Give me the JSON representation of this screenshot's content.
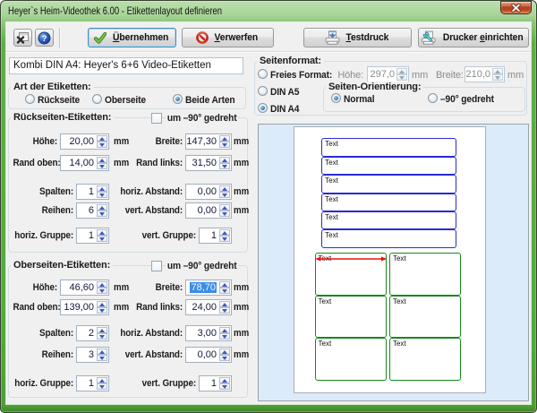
{
  "window": {
    "title": "Heyer`s Heim-Videothek 6.00 - Etikettenlayout definieren"
  },
  "toolbar": {
    "window_button_icon": "window-close-icon",
    "help_button_icon": "help-icon",
    "apply": {
      "label_prefix": "Ü",
      "label_rest": "bernehmen",
      "icon": "check-icon"
    },
    "discard": {
      "label_prefix": "V",
      "label_rest": "erwerfen",
      "icon": "no-entry-icon"
    },
    "test_print": {
      "label_prefix": "T",
      "label_rest": "estdruck",
      "icon": "printer-icon"
    },
    "printer_setup": {
      "label_pre": "Drucker ",
      "label_accel": "e",
      "label_rest": "inrichten",
      "icon": "printer-wrench-icon"
    }
  },
  "left_panel": {
    "layout_name_value": "Kombi DIN A4: Heyer's 6+6 Video-Etiketten",
    "label_type_group": {
      "legend": "Art der Etiketten:",
      "options": [
        {
          "label": "Rückseite",
          "selected": false
        },
        {
          "label": "Oberseite",
          "selected": false
        },
        {
          "label": "Beide Arten",
          "selected": true
        }
      ]
    },
    "back_labels_group": {
      "legend": "Rückseiten-Etiketten:",
      "rotated": {
        "label": "um –90° gedreht",
        "checked": false
      },
      "fields": [
        {
          "label": "Höhe:",
          "value": "20,00",
          "unit": "mm"
        },
        {
          "label": "Breite:",
          "value": "147,30",
          "unit": "mm"
        },
        {
          "label": "Rand oben:",
          "value": "14,00",
          "unit": "mm"
        },
        {
          "label": "Rand links:",
          "value": "31,50",
          "unit": "mm"
        },
        {
          "label": "Spalten:",
          "value": "1",
          "unit": ""
        },
        {
          "label": "horiz. Abstand:",
          "value": "0,00",
          "unit": "mm"
        },
        {
          "label": "Reihen:",
          "value": "6",
          "unit": ""
        },
        {
          "label": "vert. Abstand:",
          "value": "0,00",
          "unit": "mm"
        },
        {
          "label": "horiz. Gruppe:",
          "value": "1",
          "unit": ""
        },
        {
          "label": "vert. Gruppe:",
          "value": "1",
          "unit": ""
        }
      ]
    },
    "top_labels_group": {
      "legend": "Oberseiten-Etiketten:",
      "rotated": {
        "label": "um –90° gedreht",
        "checked": false
      },
      "selected_field": "Breite:",
      "fields": [
        {
          "label": "Höhe:",
          "value": "46,60",
          "unit": "mm"
        },
        {
          "label": "Breite:",
          "value": "78,70",
          "unit": "mm",
          "selected": true
        },
        {
          "label": "Rand oben:",
          "value": "139,00",
          "unit": "mm"
        },
        {
          "label": "Rand links:",
          "value": "24,00",
          "unit": "mm"
        },
        {
          "label": "Spalten:",
          "value": "2",
          "unit": ""
        },
        {
          "label": "horiz. Abstand:",
          "value": "3,00",
          "unit": "mm"
        },
        {
          "label": "Reihen:",
          "value": "3",
          "unit": ""
        },
        {
          "label": "vert. Abstand:",
          "value": "0,00",
          "unit": "mm"
        },
        {
          "label": "horiz. Gruppe:",
          "value": "1",
          "unit": ""
        },
        {
          "label": "vert. Gruppe:",
          "value": "1",
          "unit": ""
        }
      ]
    }
  },
  "right_panel": {
    "page_format_group": {
      "legend": "Seitenformat:",
      "free_format": {
        "label": "Freies Format:",
        "selected": false,
        "height": {
          "label": "Höhe:",
          "value": "297,0",
          "unit": "mm",
          "disabled": true
        },
        "width": {
          "label": "Breite:",
          "value": "210,0",
          "unit": "mm",
          "disabled": true
        }
      },
      "din_a5": {
        "label": "DIN A5",
        "selected": false
      },
      "din_a4": {
        "label": "DIN A4",
        "selected": true
      },
      "orientation_group": {
        "legend": "Seiten-Orientierung:",
        "options": [
          {
            "label": "Normal",
            "selected": true
          },
          {
            "label": "–90° gedreht",
            "selected": false
          }
        ]
      }
    },
    "preview": {
      "label_text": "Text",
      "page": {
        "width_mm": 210,
        "height_mm": 297
      },
      "back_labels": {
        "color": "#2a2ad8",
        "left_mm": 31.5,
        "top_mm": 14,
        "width_mm": 147.3,
        "height_mm": 20,
        "columns": 1,
        "rows": 6,
        "h_gap_mm": 0,
        "v_gap_mm": 0
      },
      "top_labels": {
        "color": "#17891c",
        "left_mm": 24,
        "top_mm": 139,
        "width_mm": 78.7,
        "height_mm": 46.6,
        "columns": 2,
        "rows": 3,
        "h_gap_mm": 3,
        "v_gap_mm": 0
      },
      "width_arrow": {
        "color": "#e81212",
        "on": "top-labels-first"
      }
    }
  }
}
